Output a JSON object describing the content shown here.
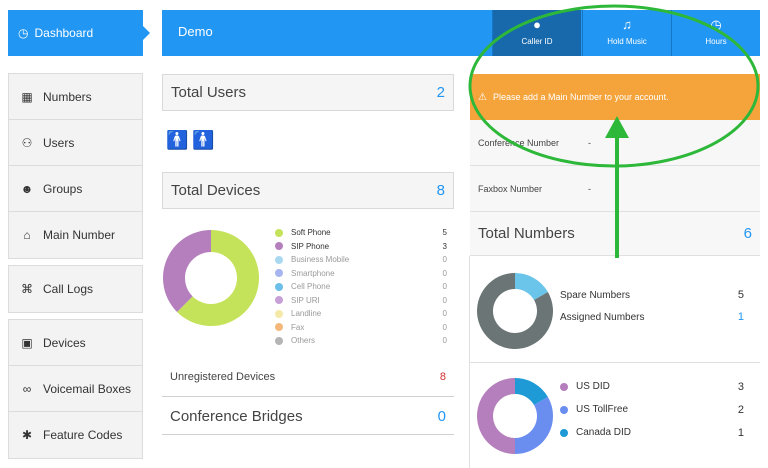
{
  "sidebar": {
    "active": {
      "label": "Dashboard",
      "icon": "speedometer-icon"
    },
    "items": [
      {
        "label": "Numbers",
        "icon": "grid-icon"
      },
      {
        "label": "Users",
        "icon": "users-icon"
      },
      {
        "label": "Groups",
        "icon": "group-icon"
      },
      {
        "label": "Main Number",
        "icon": "home-icon"
      },
      {
        "label": "Call Logs",
        "icon": "call-logs-icon"
      },
      {
        "label": "Devices",
        "icon": "devices-icon"
      },
      {
        "label": "Voicemail Boxes",
        "icon": "voicemail-icon"
      },
      {
        "label": "Feature Codes",
        "icon": "asterisk-icon"
      }
    ]
  },
  "topbar": {
    "title": "Demo",
    "buttons": [
      {
        "label": "Caller ID",
        "icon": "caller-id-icon"
      },
      {
        "label": "Hold Music",
        "icon": "music-note-icon"
      },
      {
        "label": "Hours",
        "icon": "clock-icon"
      }
    ]
  },
  "users": {
    "title": "Total Users",
    "count": "2"
  },
  "devices": {
    "title": "Total Devices",
    "count": "8",
    "legend": [
      {
        "label": "Soft Phone",
        "value": "5",
        "color": "#c5e35a"
      },
      {
        "label": "SIP Phone",
        "value": "3",
        "color": "#b57ebc"
      },
      {
        "label": "Business Mobile",
        "value": "0",
        "color": "#a9d8f0"
      },
      {
        "label": "Smartphone",
        "value": "0",
        "color": "#a6b4f0"
      },
      {
        "label": "Cell Phone",
        "value": "0",
        "color": "#6bbfe8"
      },
      {
        "label": "SIP URI",
        "value": "0",
        "color": "#c7a0d8"
      },
      {
        "label": "Landline",
        "value": "0",
        "color": "#f5e9a8"
      },
      {
        "label": "Fax",
        "value": "0",
        "color": "#f5b87a"
      },
      {
        "label": "Others",
        "value": "0",
        "color": "#b5b5b5"
      }
    ],
    "unregistered": {
      "label": "Unregistered Devices",
      "count": "8"
    }
  },
  "conference": {
    "title": "Conference Bridges",
    "count": "0"
  },
  "alert": {
    "text": "Please add a Main Number to your account."
  },
  "info": {
    "conference": {
      "label": "Conference Number",
      "value": "-"
    },
    "faxbox": {
      "label": "Faxbox Number",
      "value": "-"
    }
  },
  "numbers": {
    "title": "Total Numbers",
    "count": "6",
    "spare": {
      "label": "Spare Numbers",
      "value": "5",
      "color": "#6b7576"
    },
    "assigned": {
      "label": "Assigned Numbers",
      "value": "1",
      "color": "#6bc5ea"
    },
    "types": [
      {
        "label": "US DID",
        "value": "3",
        "color": "#b57ebc"
      },
      {
        "label": "US TollFree",
        "value": "2",
        "color": "#6a8ef0"
      },
      {
        "label": "Canada DID",
        "value": "1",
        "color": "#1e9ad6"
      }
    ]
  },
  "colors": {
    "accent": "#2196f3",
    "alert": "#f5a43c",
    "annotation": "#2eb83a",
    "danger": "#d32f2f"
  }
}
